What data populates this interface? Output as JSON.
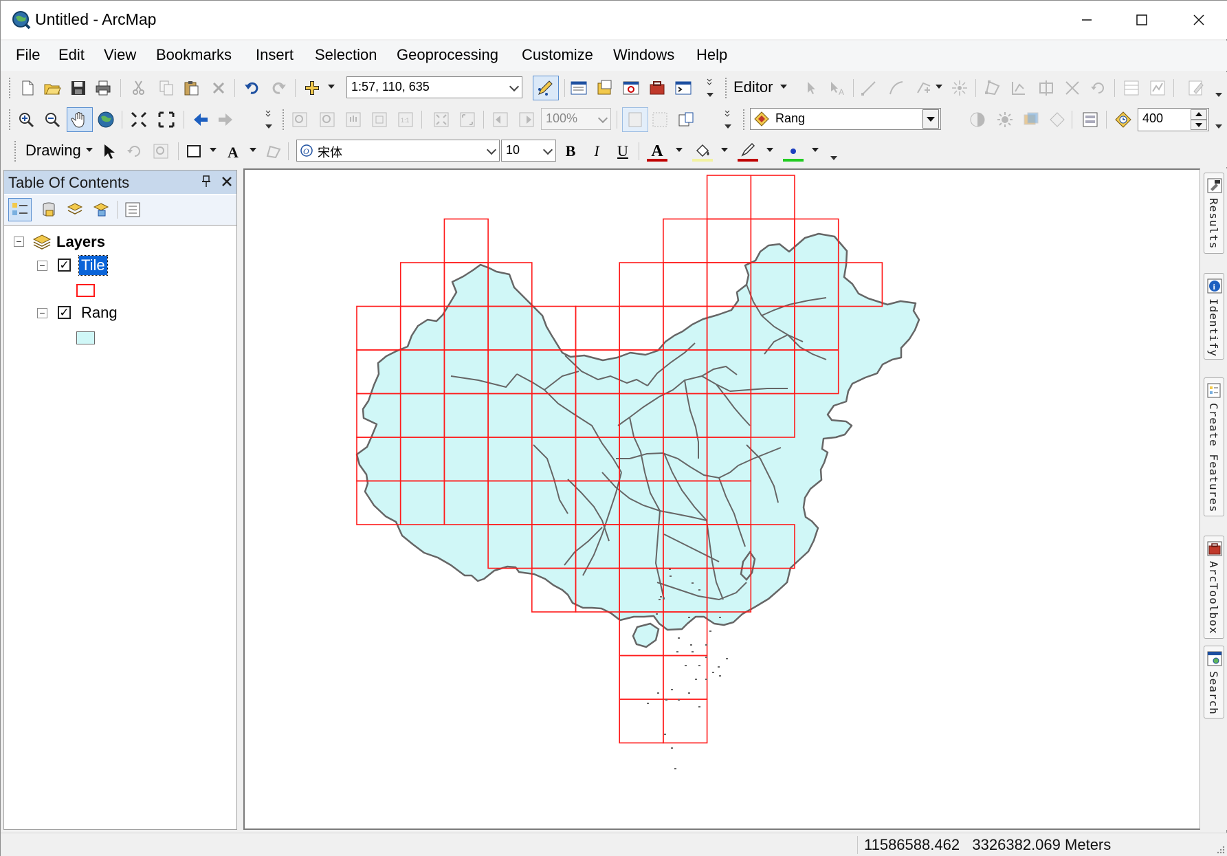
{
  "window": {
    "title": "Untitled - ArcMap",
    "controls": {
      "minimize": "minimize",
      "maximize": "maximize",
      "close": "close"
    }
  },
  "menu": [
    "File",
    "Edit",
    "View",
    "Bookmarks",
    "Insert",
    "Selection",
    "Geoprocessing",
    "Customize",
    "Windows",
    "Help"
  ],
  "toolbar_standard": {
    "map_scale": "1:57, 110, 635",
    "editor_label": "Editor"
  },
  "toolbar_tools": {
    "layout_zoom": "100%",
    "effects_layer": "Rang",
    "resolution": "400"
  },
  "toolbar_drawing": {
    "drawing_label": "Drawing",
    "font_name": "宋体",
    "font_size": "10",
    "bold": "B",
    "italic": "I",
    "underline": "U",
    "text_color_glyph": "A",
    "colors": {
      "font": "#c00000",
      "fill": "#f2f2a0",
      "line": "#c00000",
      "marker": "#22cc22"
    }
  },
  "toc": {
    "title": "Table Of Contents",
    "root": "Layers",
    "layers": [
      {
        "name": "Tile",
        "checked": true,
        "selected": true,
        "symbol": "hollow red outline"
      },
      {
        "name": "Rang",
        "checked": true,
        "selected": false,
        "symbol": "light cyan fill, gray outline"
      }
    ]
  },
  "map": {
    "tile_outline_color": "#ff1a1a",
    "region_fill_color": "#d0f7f7",
    "region_outline_color": "#666666"
  },
  "right_dock": [
    "Results",
    "Identify",
    "Create Features",
    "ArcToolbox",
    "Search"
  ],
  "status": {
    "x": "11586588.462",
    "y": "3326382.069",
    "units": "Meters"
  }
}
